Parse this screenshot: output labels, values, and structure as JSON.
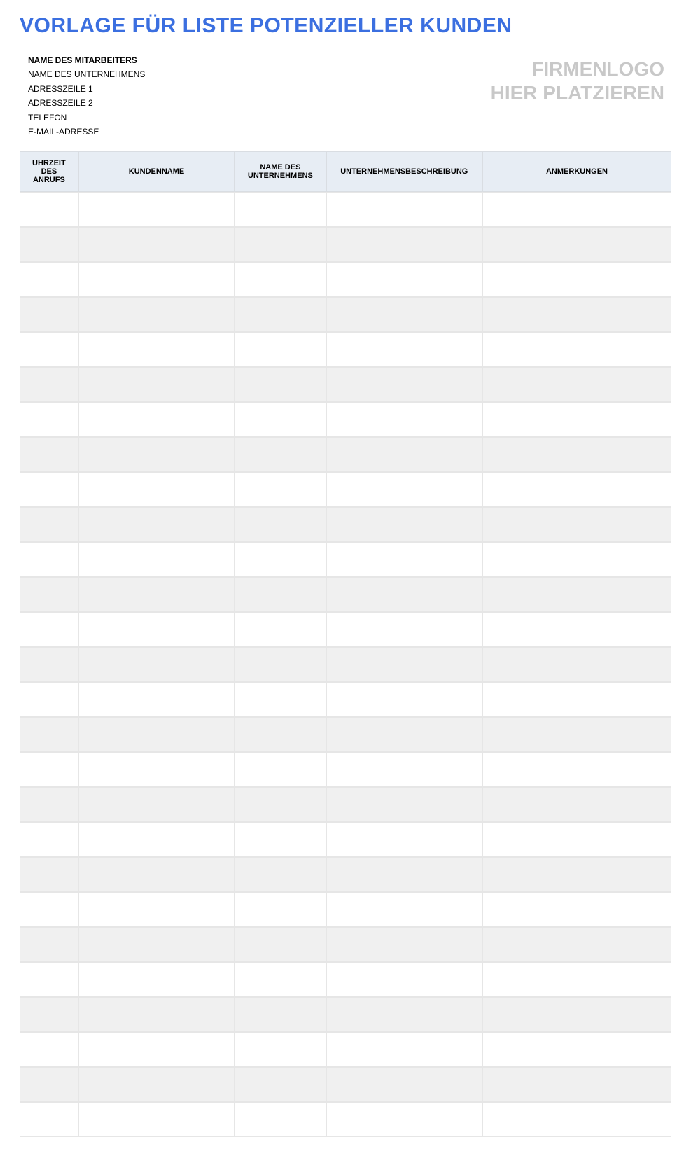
{
  "title": "VORLAGE FÜR LISTE POTENZIELLER KUNDEN",
  "employee": {
    "name_label": "NAME DES MITARBEITERS",
    "company_label": "NAME DES UNTERNEHMENS",
    "address1_label": "ADRESSZEILE 1",
    "address2_label": "ADRESSZEILE 2",
    "phone_label": "TELEFON",
    "email_label": "E-MAIL-ADRESSE"
  },
  "logo_placeholder": {
    "line1": "FIRMENLOGO",
    "line2": "HIER PLATZIEREN"
  },
  "table": {
    "headers": {
      "call_time": "UHRZEIT DES ANRUFS",
      "client_name": "KUNDENNAME",
      "company_name": "NAME DES UNTERNEHMENS",
      "company_desc": "UNTERNEHMENSBESCHREIBUNG",
      "notes": "ANMERKUNGEN"
    },
    "row_count": 27
  }
}
